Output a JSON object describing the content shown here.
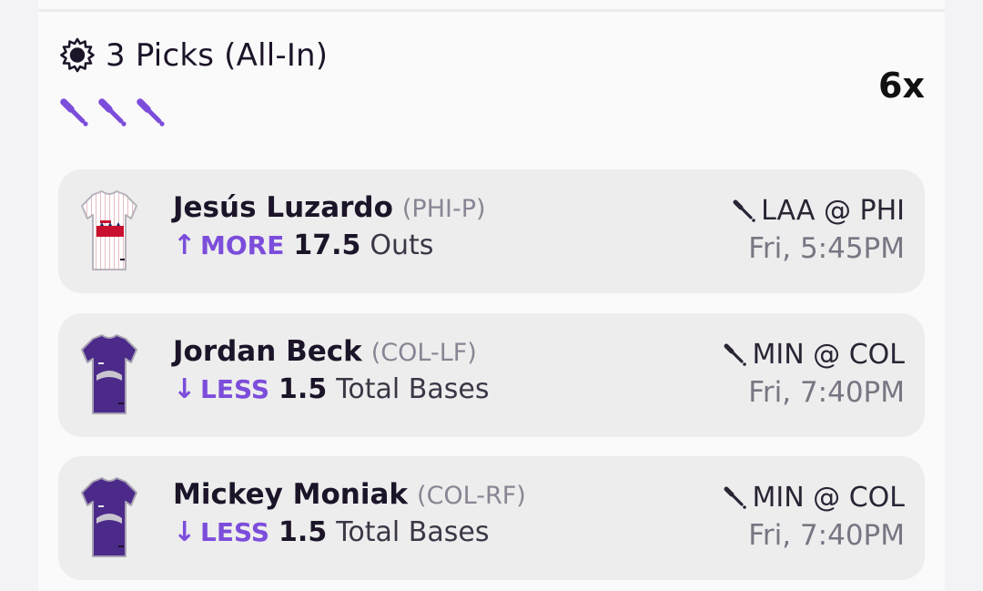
{
  "entry": {
    "title": "3 Picks (All-In)",
    "multiplier": "6x",
    "sport_icon_count": 3
  },
  "picks": [
    {
      "player": "Jesús Luzardo",
      "position": "(PHI-P)",
      "direction": "MORE",
      "arrow": "↑",
      "line": "17.5",
      "stat": "Outs",
      "matchup": "LAA @ PHI",
      "time": "Fri, 5:45PM",
      "jersey": "phillies-pinstripe-jersey"
    },
    {
      "player": "Jordan Beck",
      "position": "(COL-LF)",
      "direction": "LESS",
      "arrow": "↓",
      "line": "1.5",
      "stat": "Total Bases",
      "matchup": "MIN @ COL",
      "time": "Fri, 7:40PM",
      "jersey": "rockies-purple-jersey"
    },
    {
      "player": "Mickey Moniak",
      "position": "(COL-RF)",
      "direction": "LESS",
      "arrow": "↓",
      "line": "1.5",
      "stat": "Total Bases",
      "matchup": "MIN @ COL",
      "time": "Fri, 7:40PM",
      "jersey": "rockies-purple-jersey"
    }
  ],
  "colors": {
    "accent": "#7c4ddb",
    "card_bg": "#ededed",
    "page_bg": "#fafafa"
  }
}
